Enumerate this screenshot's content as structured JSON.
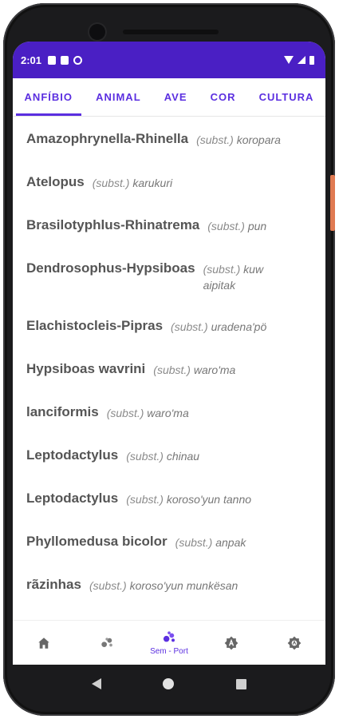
{
  "status": {
    "time": "2:01"
  },
  "tabs": [
    {
      "label": "ANFÍBIO",
      "active": true
    },
    {
      "label": "ANIMAL",
      "active": false
    },
    {
      "label": "AVE",
      "active": false
    },
    {
      "label": "COR",
      "active": false
    },
    {
      "label": "CULTURA",
      "active": false
    }
  ],
  "entries": [
    {
      "term": "Amazophrynella-Rhinella",
      "pos": "(subst.)",
      "translation": "koropara"
    },
    {
      "term": "Atelopus",
      "pos": "(subst.)",
      "translation": "karukuri"
    },
    {
      "term": "Brasilotyphlus-Rhinatrema",
      "pos": "(subst.)",
      "translation": "pun"
    },
    {
      "term": "Dendrosophus-Hypsiboas",
      "pos": "(subst.)",
      "translation": "kuwaipitak"
    },
    {
      "term": "Elachistocleis-Pipras",
      "pos": "(subst.)",
      "translation": "uradena'pö"
    },
    {
      "term": "Hypsiboas wavrini",
      "pos": "(subst.)",
      "translation": "waro'ma"
    },
    {
      "term": "lanciformis",
      "pos": "(subst.)",
      "translation": "waro'ma"
    },
    {
      "term": "Leptodactylus",
      "pos": "(subst.)",
      "translation": "chinau"
    },
    {
      "term": "Leptodactylus",
      "pos": "(subst.)",
      "translation": "koroso'yun tanno"
    },
    {
      "term": "Phyllomedusa bicolor",
      "pos": "(subst.)",
      "translation": "anpak"
    },
    {
      "term": "rãzinhas",
      "pos": "(subst.)",
      "translation": "koroso'yun munkësan"
    }
  ],
  "bottom_nav": {
    "items": [
      {
        "icon": "home-icon"
      },
      {
        "icon": "paw-icon"
      },
      {
        "icon": "paw-active-icon",
        "label": "Sem - Port"
      },
      {
        "icon": "badge-a-icon"
      },
      {
        "icon": "badge-a-settings-icon"
      }
    ]
  },
  "colors": {
    "primary": "#5b2fe0",
    "statusbar": "#4a1fc4",
    "text": "#555555"
  }
}
